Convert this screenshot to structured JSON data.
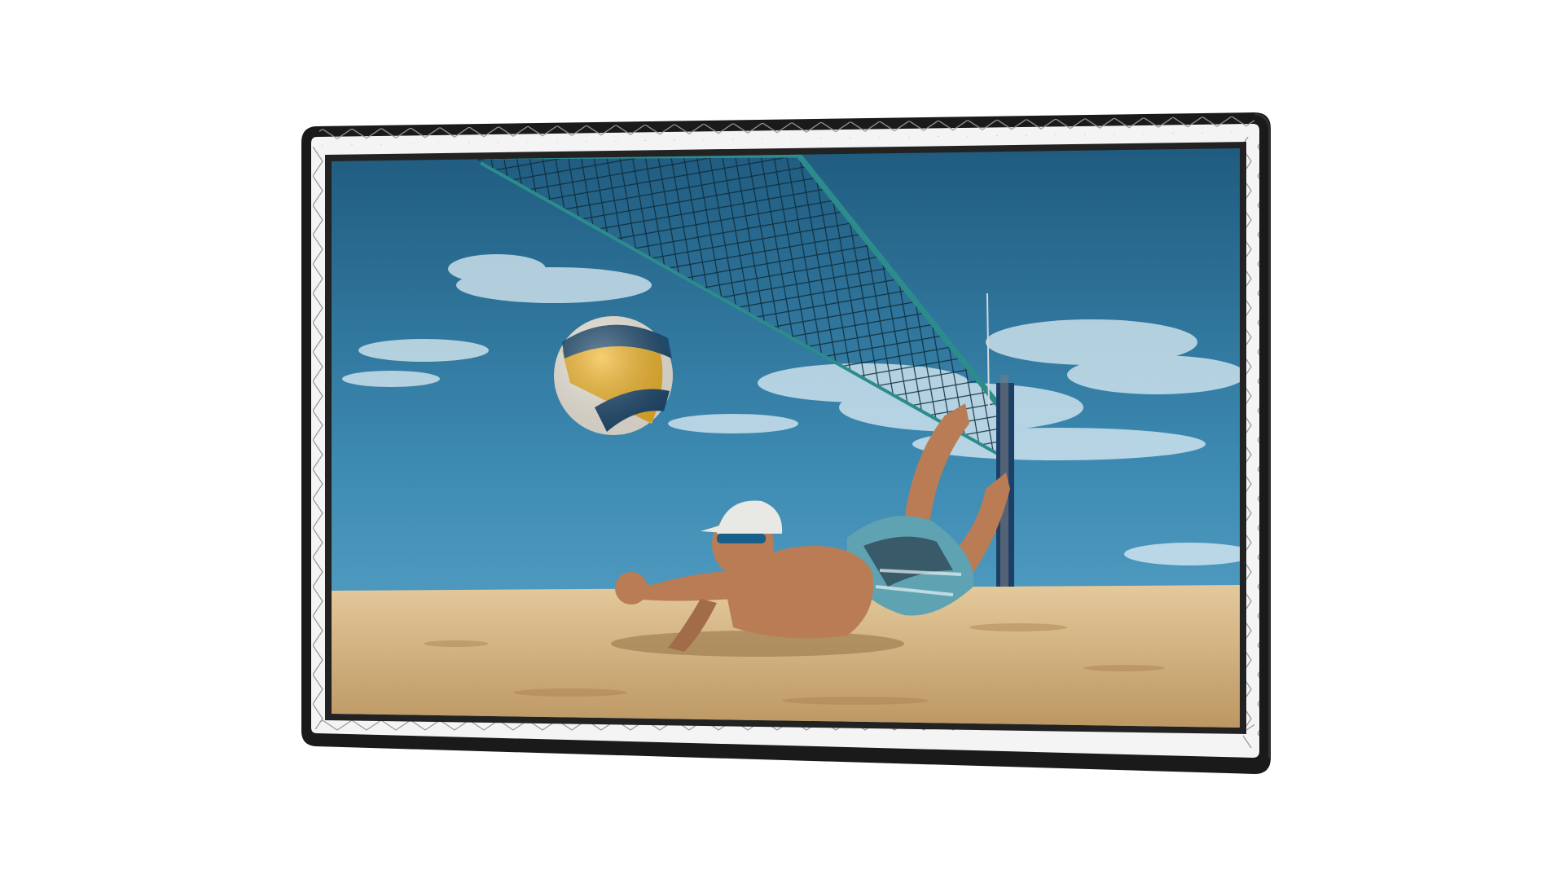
{
  "product": {
    "image_subject": "projector-screen-with-frame",
    "frame_color": "#1a1a1a",
    "border_color": "#f4f4f4",
    "lacing_color": "#9a9a9a"
  },
  "scene": {
    "sky_top": "#1f5a7e",
    "sky_mid": "#3d8bb3",
    "sky_horizon": "#63a9cc",
    "sand_light": "#e4c99b",
    "sand_dark": "#b8925d",
    "net_color": "#2c8c8c",
    "ball_colors": [
      "#f2b62a",
      "#1f4a6e",
      "#f4efe2"
    ],
    "cap_color": "#e8e8e4",
    "shorts_color": "#5fa3b2",
    "skin_color": "#b97c55"
  }
}
